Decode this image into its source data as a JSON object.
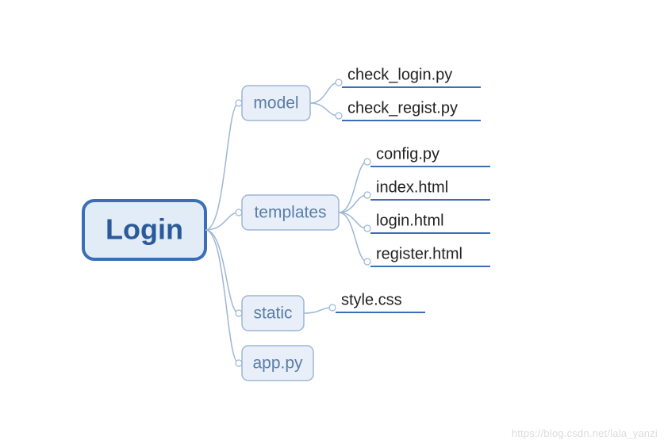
{
  "root": {
    "label": "Login"
  },
  "children": [
    {
      "key": "model",
      "label": "model",
      "leaves": [
        "check_login.py",
        "check_regist.py"
      ]
    },
    {
      "key": "templates",
      "label": "templates",
      "leaves": [
        "config.py",
        "index.html",
        "login.html",
        "register.html"
      ]
    },
    {
      "key": "static",
      "label": "static",
      "leaves": [
        "style.css"
      ]
    },
    {
      "key": "app",
      "label": "app.py",
      "leaves": []
    }
  ],
  "watermark": "https://blog.csdn.net/lala_yanzi"
}
